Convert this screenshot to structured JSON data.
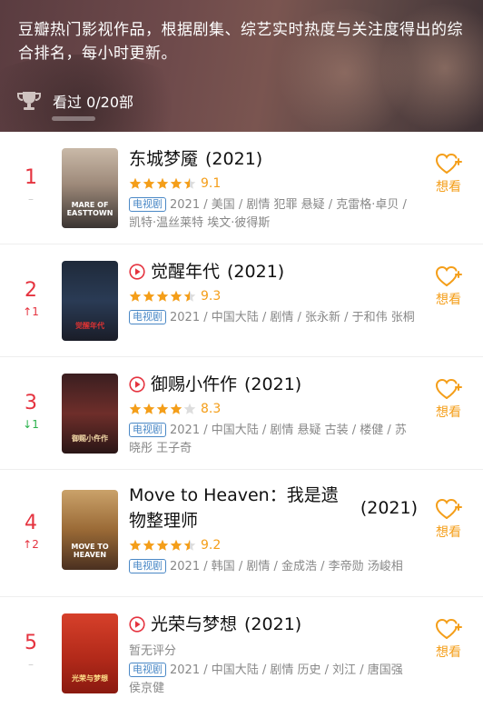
{
  "header": {
    "description": "豆瓣热门影视作品，根据剧集、综艺实时热度与关注度得出的综合排名，每小时更新。",
    "progress_text": "看过  0/20部"
  },
  "colors": {
    "rank_red": "#e5333f",
    "star_orange": "#f49e19",
    "tag_blue": "#4a88c6",
    "down_green": "#2bb24c"
  },
  "items": [
    {
      "rank": "1",
      "change": "–",
      "change_dir": "none",
      "title": "东城梦魇",
      "year": "(2021)",
      "playable": false,
      "rating_stars": 4.5,
      "score": "9.1",
      "tag": "电视剧",
      "meta": "2021 / 美国 / 剧情 犯罪 悬疑 / 克雷格·卓贝 / 凯特·温丝莱特 埃文·彼得斯",
      "want_label": "想看",
      "poster_text": "MARE OF EASTTOWN"
    },
    {
      "rank": "2",
      "change": "↑1",
      "change_dir": "up",
      "title": "觉醒年代",
      "year": "(2021)",
      "playable": true,
      "rating_stars": 4.5,
      "score": "9.3",
      "tag": "电视剧",
      "meta": "2021 / 中国大陆 / 剧情 / 张永新 / 于和伟 张桐",
      "want_label": "想看",
      "poster_text": "觉醒年代"
    },
    {
      "rank": "3",
      "change": "↓1",
      "change_dir": "down",
      "title": "御赐小仵作",
      "year": "(2021)",
      "playable": true,
      "rating_stars": 4,
      "score": "8.3",
      "tag": "电视剧",
      "meta": "2021 / 中国大陆 / 剧情 悬疑 古装 / 楼健 / 苏晓彤 王子奇",
      "want_label": "想看",
      "poster_text": "御赐小仵作"
    },
    {
      "rank": "4",
      "change": "↑2",
      "change_dir": "up",
      "title": "Move to Heaven：我是遗物整理师",
      "year": "(2021)",
      "playable": false,
      "rating_stars": 4.5,
      "score": "9.2",
      "tag": "电视剧",
      "meta": "2021 / 韩国 / 剧情 / 金成浩 / 李帝勋 汤峻相",
      "want_label": "想看",
      "poster_text": "MOVE TO HEAVEN"
    },
    {
      "rank": "5",
      "change": "–",
      "change_dir": "none",
      "title": "光荣与梦想",
      "year": "(2021)",
      "playable": true,
      "rating_stars": 0,
      "score": "",
      "no_score_text": "暂无评分",
      "tag": "电视剧",
      "meta": "2021 / 中国大陆 / 剧情 历史 / 刘江 / 唐国强 侯京健",
      "want_label": "想看",
      "poster_text": "光荣与梦想"
    }
  ]
}
